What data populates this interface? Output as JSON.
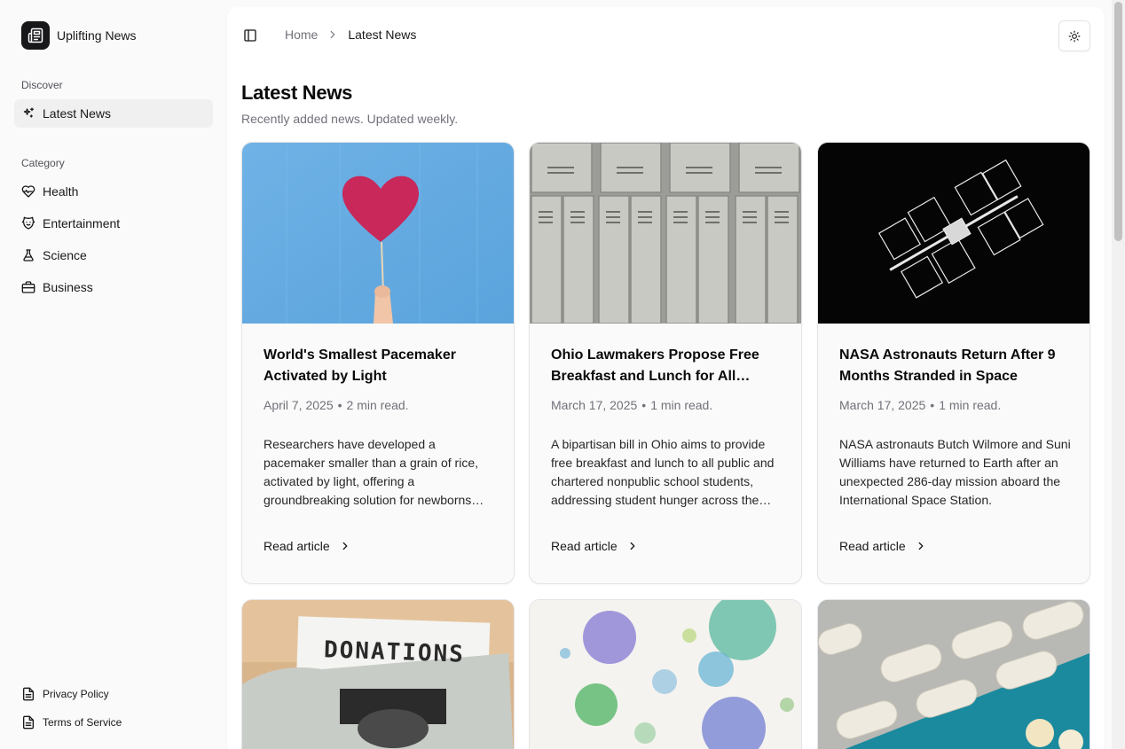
{
  "brand": {
    "name": "Uplifting News",
    "logo_icon": "newspaper-icon"
  },
  "sidebar": {
    "discover_label": "Discover",
    "discover_items": [
      {
        "label": "Latest News",
        "icon": "sparkles-icon",
        "active": true
      }
    ],
    "category_label": "Category",
    "category_items": [
      {
        "label": "Health",
        "icon": "heart-pulse-icon"
      },
      {
        "label": "Entertainment",
        "icon": "theater-masks-icon"
      },
      {
        "label": "Science",
        "icon": "flask-icon"
      },
      {
        "label": "Business",
        "icon": "briefcase-icon"
      }
    ],
    "footer_items": [
      {
        "label": "Privacy Policy",
        "icon": "document-icon"
      },
      {
        "label": "Terms of Service",
        "icon": "document-icon"
      }
    ]
  },
  "header": {
    "breadcrumb": {
      "home": "Home",
      "current": "Latest News"
    },
    "sidebar_toggle_icon": "panel-left-icon",
    "theme_toggle_icon": "sun-icon"
  },
  "page": {
    "title": "Latest News",
    "subtitle": "Recently added news. Updated weekly."
  },
  "articles": [
    {
      "title": "World's Smallest Pacemaker Activated by Light",
      "date": "April 7, 2025",
      "separator": "•",
      "read_time": "2 min read.",
      "description": "Researchers have developed a pacemaker smaller than a grain of rice, activated by light, offering a groundbreaking solution for newborns with heart conditions.",
      "link_label": "Read article",
      "image": "red-heart-balloon-photo"
    },
    {
      "title": "Ohio Lawmakers Propose Free Breakfast and Lunch for All Students",
      "date": "March 17, 2025",
      "separator": "•",
      "read_time": "1 min read.",
      "description": "A bipartisan bill in Ohio aims to provide free breakfast and lunch to all public and chartered nonpublic school students, addressing student hunger across the state.",
      "link_label": "Read article",
      "image": "school-lockers-photo"
    },
    {
      "title": "NASA Astronauts Return After 9 Months Stranded in Space",
      "date": "March 17, 2025",
      "separator": "•",
      "read_time": "1 min read.",
      "description": "NASA astronauts Butch Wilmore and Suni Williams have returned to Earth after an unexpected 286-day mission aboard the International Space Station.",
      "link_label": "Read article",
      "image": "space-station-photo"
    }
  ],
  "more_articles": [
    {
      "image": "typewriter-donations-photo",
      "image_text": "DONATIONS"
    },
    {
      "image": "watercolor-viruses-photo"
    },
    {
      "image": "pills-blister-pack-photo"
    }
  ],
  "colors": {
    "accent": "#18181b",
    "muted": "#71717a",
    "border": "#e4e4e7",
    "sidebar_bg": "#fafafa"
  }
}
